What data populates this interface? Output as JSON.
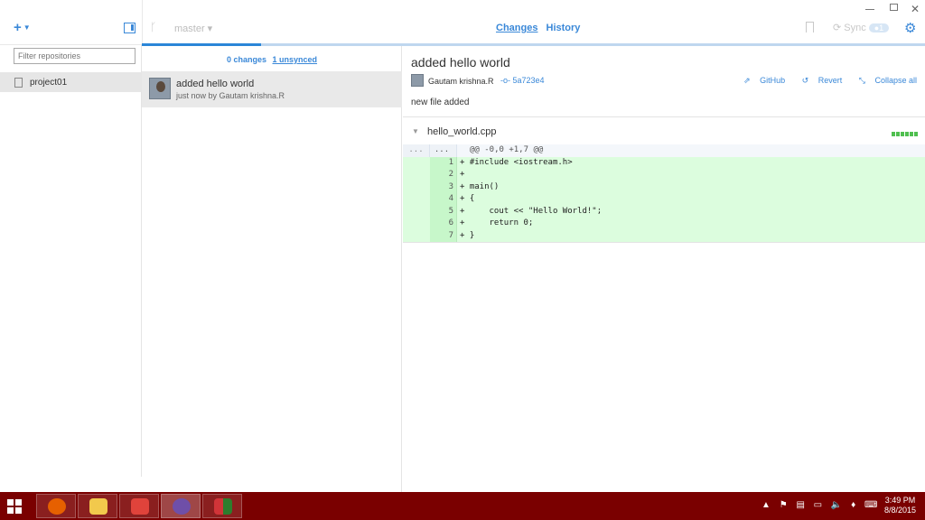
{
  "toolbar": {
    "add_label": "+",
    "branch": "master",
    "tabs": [
      {
        "label": "Changes",
        "active": true
      },
      {
        "label": "History",
        "active": false
      }
    ],
    "sync_label": "Sync",
    "accent_color": "#3a88d8"
  },
  "sidebar": {
    "filter_placeholder": "Filter repositories",
    "repos": [
      {
        "name": "project01",
        "selected": true
      }
    ]
  },
  "middle": {
    "changes_label": "0 changes",
    "unsynced_label": "1 unsynced",
    "commits": [
      {
        "title": "added hello world",
        "meta": "just now by Gautam krishna.R"
      }
    ]
  },
  "detail": {
    "title": "added hello world",
    "author": "Gautam krishna.R",
    "sha": "5a723e4",
    "actions": {
      "github": "GitHub",
      "revert": "Revert",
      "collapse": "Collapse all"
    },
    "description": "new file added",
    "file": {
      "name": "hello_world.cpp",
      "hunk_header": "@@ -0,0 +1,7 @@",
      "hunk_old": "...",
      "hunk_new": "...",
      "added_lines": 7,
      "lines": [
        {
          "n": "1",
          "text": "+ #include <iostream.h>"
        },
        {
          "n": "2",
          "text": "+"
        },
        {
          "n": "3",
          "text": "+ main()"
        },
        {
          "n": "4",
          "text": "+ {"
        },
        {
          "n": "5",
          "text": "+     cout << \"Hello World!\";"
        },
        {
          "n": "6",
          "text": "+     return 0;"
        },
        {
          "n": "7",
          "text": "+ }"
        }
      ]
    }
  },
  "taskbar": {
    "apps": [
      {
        "name": "firefox",
        "color": "#e66000"
      },
      {
        "name": "file-explorer",
        "color": "#f2c94c"
      },
      {
        "name": "people",
        "color": "#e0433b"
      },
      {
        "name": "github",
        "color": "#6f4fa8"
      },
      {
        "name": "office",
        "color": "#d13438"
      }
    ],
    "time": "3:49 PM",
    "date": "8/8/2015"
  }
}
